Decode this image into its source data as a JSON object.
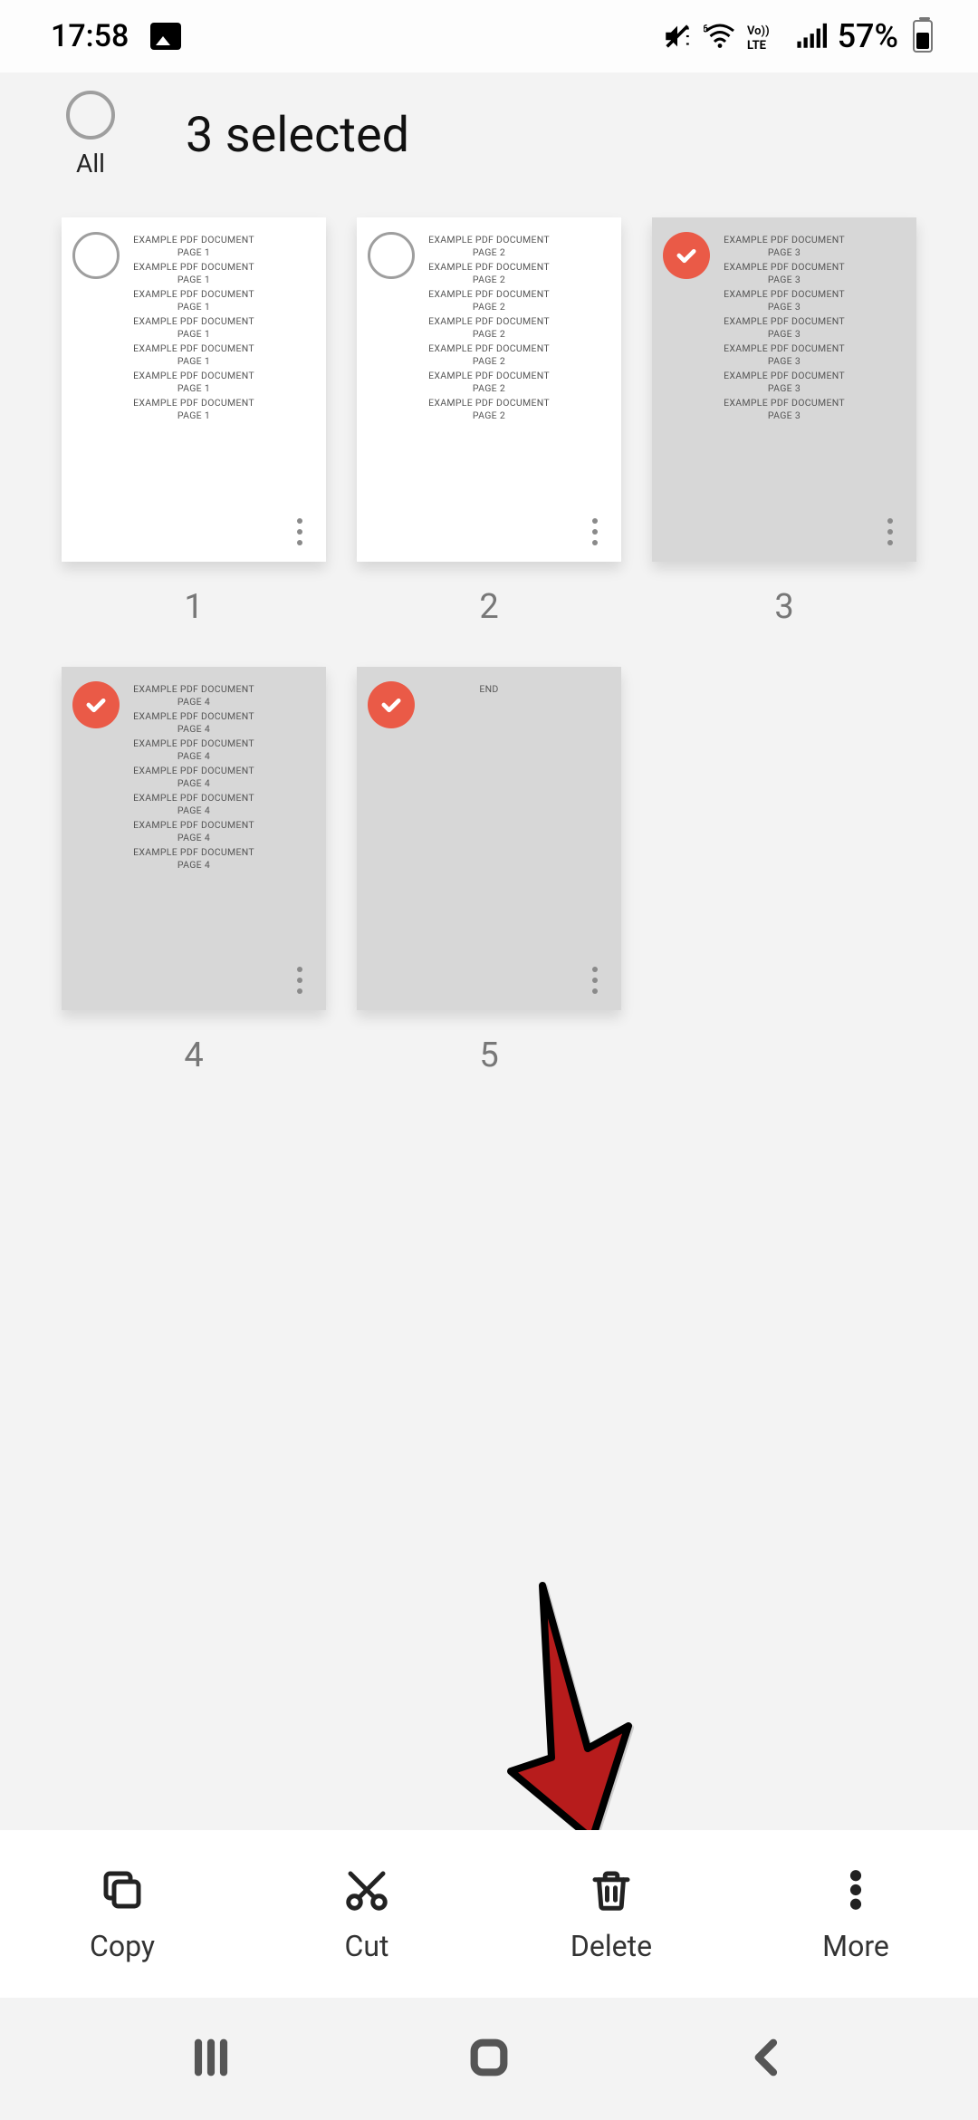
{
  "status": {
    "time": "17:58",
    "battery_text": "57%"
  },
  "header": {
    "all_label": "All",
    "title": "3 selected"
  },
  "thumbnail": {
    "heading": "EXAMPLE PDF DOCUMENT",
    "page_prefix": "PAGE",
    "end_text": "END"
  },
  "pages": [
    {
      "number": "1",
      "page_label": "PAGE 1",
      "selected": false,
      "is_end": false
    },
    {
      "number": "2",
      "page_label": "PAGE 2",
      "selected": false,
      "is_end": false
    },
    {
      "number": "3",
      "page_label": "PAGE 3",
      "selected": true,
      "is_end": false
    },
    {
      "number": "4",
      "page_label": "PAGE 4",
      "selected": true,
      "is_end": false
    },
    {
      "number": "5",
      "page_label": "",
      "selected": true,
      "is_end": true
    }
  ],
  "actions": {
    "copy": "Copy",
    "cut": "Cut",
    "delete": "Delete",
    "more": "More"
  }
}
